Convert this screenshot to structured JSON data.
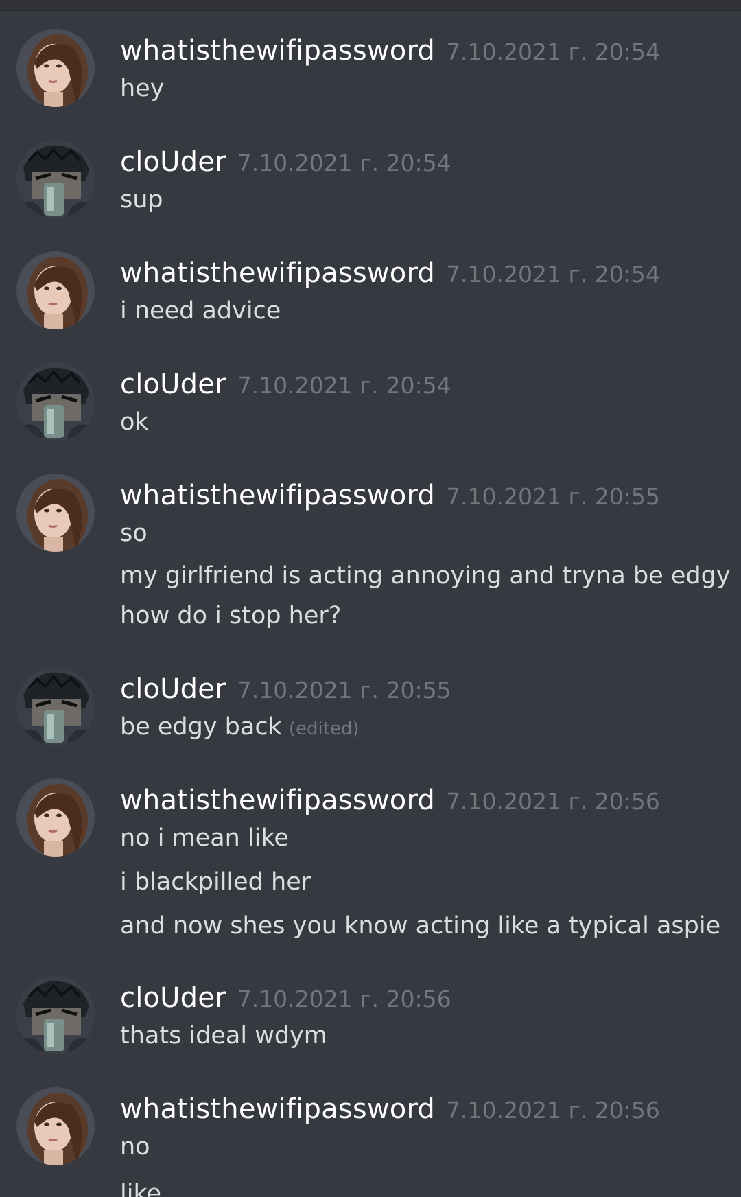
{
  "messages": [
    {
      "author": "whatisthewifipassword",
      "avatar": "girl-avatar",
      "timestamp": "7.10.2021 г. 20:54",
      "lines": [
        "hey"
      ]
    },
    {
      "author": "cloUder",
      "avatar": "anime-avatar",
      "timestamp": "7.10.2021 г. 20:54",
      "lines": [
        "sup"
      ]
    },
    {
      "author": "whatisthewifipassword",
      "avatar": "girl-avatar",
      "timestamp": "7.10.2021 г. 20:54",
      "lines": [
        "i need advice"
      ]
    },
    {
      "author": "cloUder",
      "avatar": "anime-avatar",
      "timestamp": "7.10.2021 г. 20:54",
      "lines": [
        "ok"
      ]
    },
    {
      "author": "whatisthewifipassword",
      "avatar": "girl-avatar",
      "timestamp": "7.10.2021 г. 20:55",
      "lines": [
        "so",
        "my girlfriend is acting annoying and tryna be edgy",
        "how do i stop her?"
      ]
    },
    {
      "author": "cloUder",
      "avatar": "anime-avatar",
      "timestamp": "7.10.2021 г. 20:55",
      "lines": [
        "be edgy back"
      ],
      "edited_label": "(edited)"
    },
    {
      "author": "whatisthewifipassword",
      "avatar": "girl-avatar",
      "timestamp": "7.10.2021 г. 20:56",
      "lines": [
        "no i mean like",
        "i blackpilled her",
        "and now shes you know acting like a typical aspie"
      ]
    },
    {
      "author": "cloUder",
      "avatar": "anime-avatar",
      "timestamp": "7.10.2021 г. 20:56",
      "lines": [
        "thats ideal wdym"
      ]
    },
    {
      "author": "whatisthewifipassword",
      "avatar": "girl-avatar",
      "timestamp": "7.10.2021 г. 20:56",
      "lines": [
        "no",
        "like"
      ]
    }
  ],
  "colors": {
    "background": "#36393f",
    "username": "#ffffff",
    "timestamp": "#72767d",
    "message_text": "#dcddde"
  }
}
